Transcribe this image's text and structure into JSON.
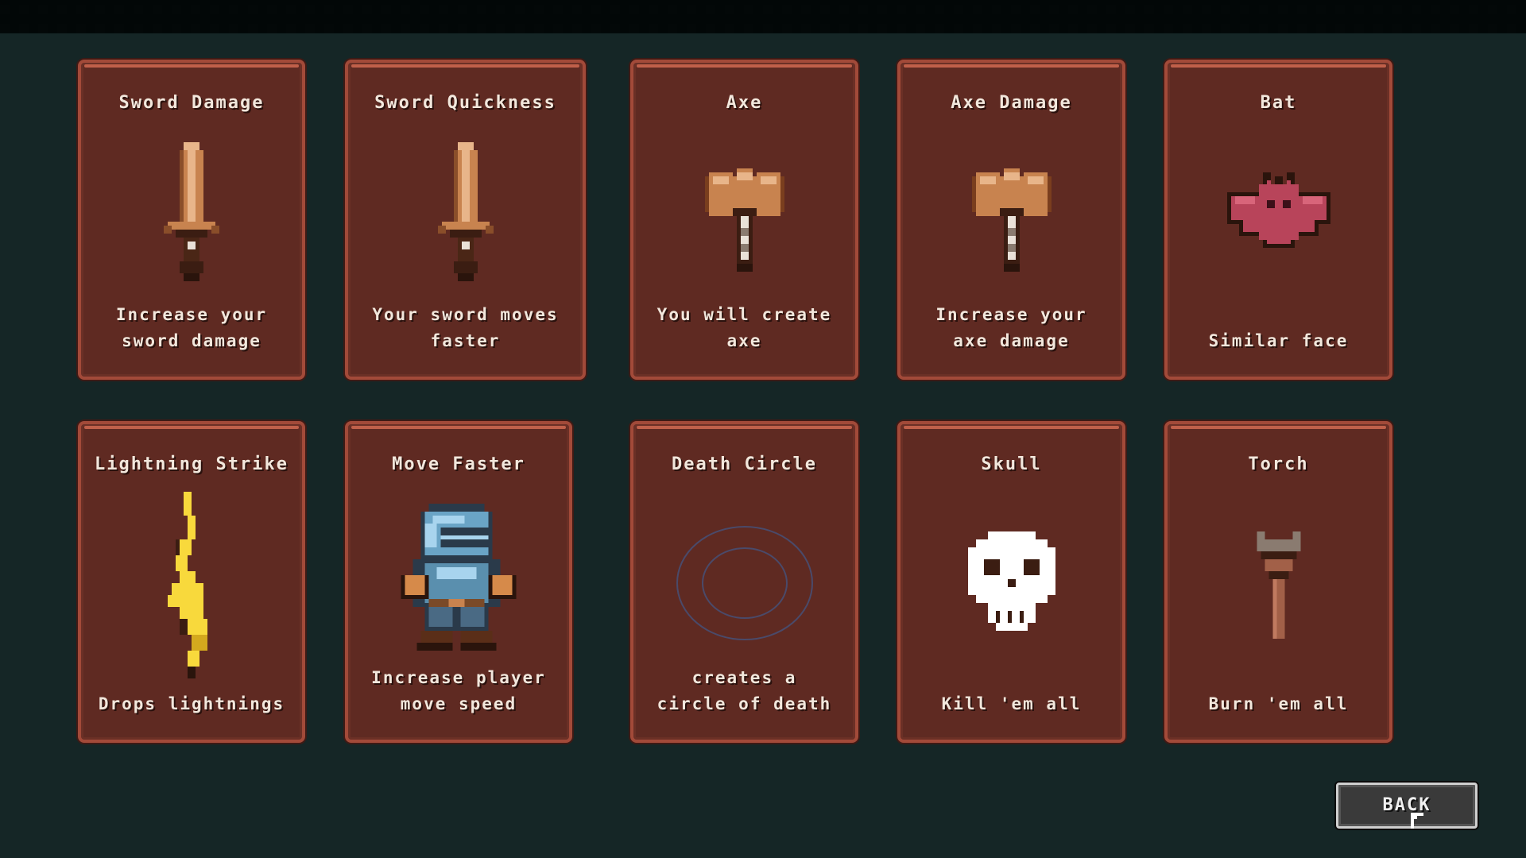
{
  "cards": [
    {
      "title": "Sword Damage",
      "description": "Increase your\nsword damage",
      "icon": "sword-icon"
    },
    {
      "title": "Sword Quickness",
      "description": "Your sword moves\nfaster",
      "icon": "sword-icon"
    },
    {
      "title": "Axe",
      "description": "You will create\naxe",
      "icon": "axe-icon"
    },
    {
      "title": "Axe Damage",
      "description": "Increase your\naxe damage",
      "icon": "axe-icon"
    },
    {
      "title": "Bat",
      "description": "Similar face",
      "icon": "bat-icon"
    },
    {
      "title": "Lightning Strike",
      "description": "Drops lightnings",
      "icon": "lightning-icon"
    },
    {
      "title": "Move Faster",
      "description": "Increase player\nmove speed",
      "icon": "knight-icon"
    },
    {
      "title": "Death Circle",
      "description": "creates a\ncircle of death",
      "icon": "death-circle-icon"
    },
    {
      "title": "Skull",
      "description": "Kill 'em all",
      "icon": "skull-icon"
    },
    {
      "title": "Torch",
      "description": "Burn 'em all",
      "icon": "torch-icon"
    }
  ],
  "back_button": {
    "label": "BACK"
  },
  "colors": {
    "background": "#152626",
    "card_fill": "#5f2a22",
    "card_border": "#a24a39",
    "text": "#f2e7dc"
  }
}
